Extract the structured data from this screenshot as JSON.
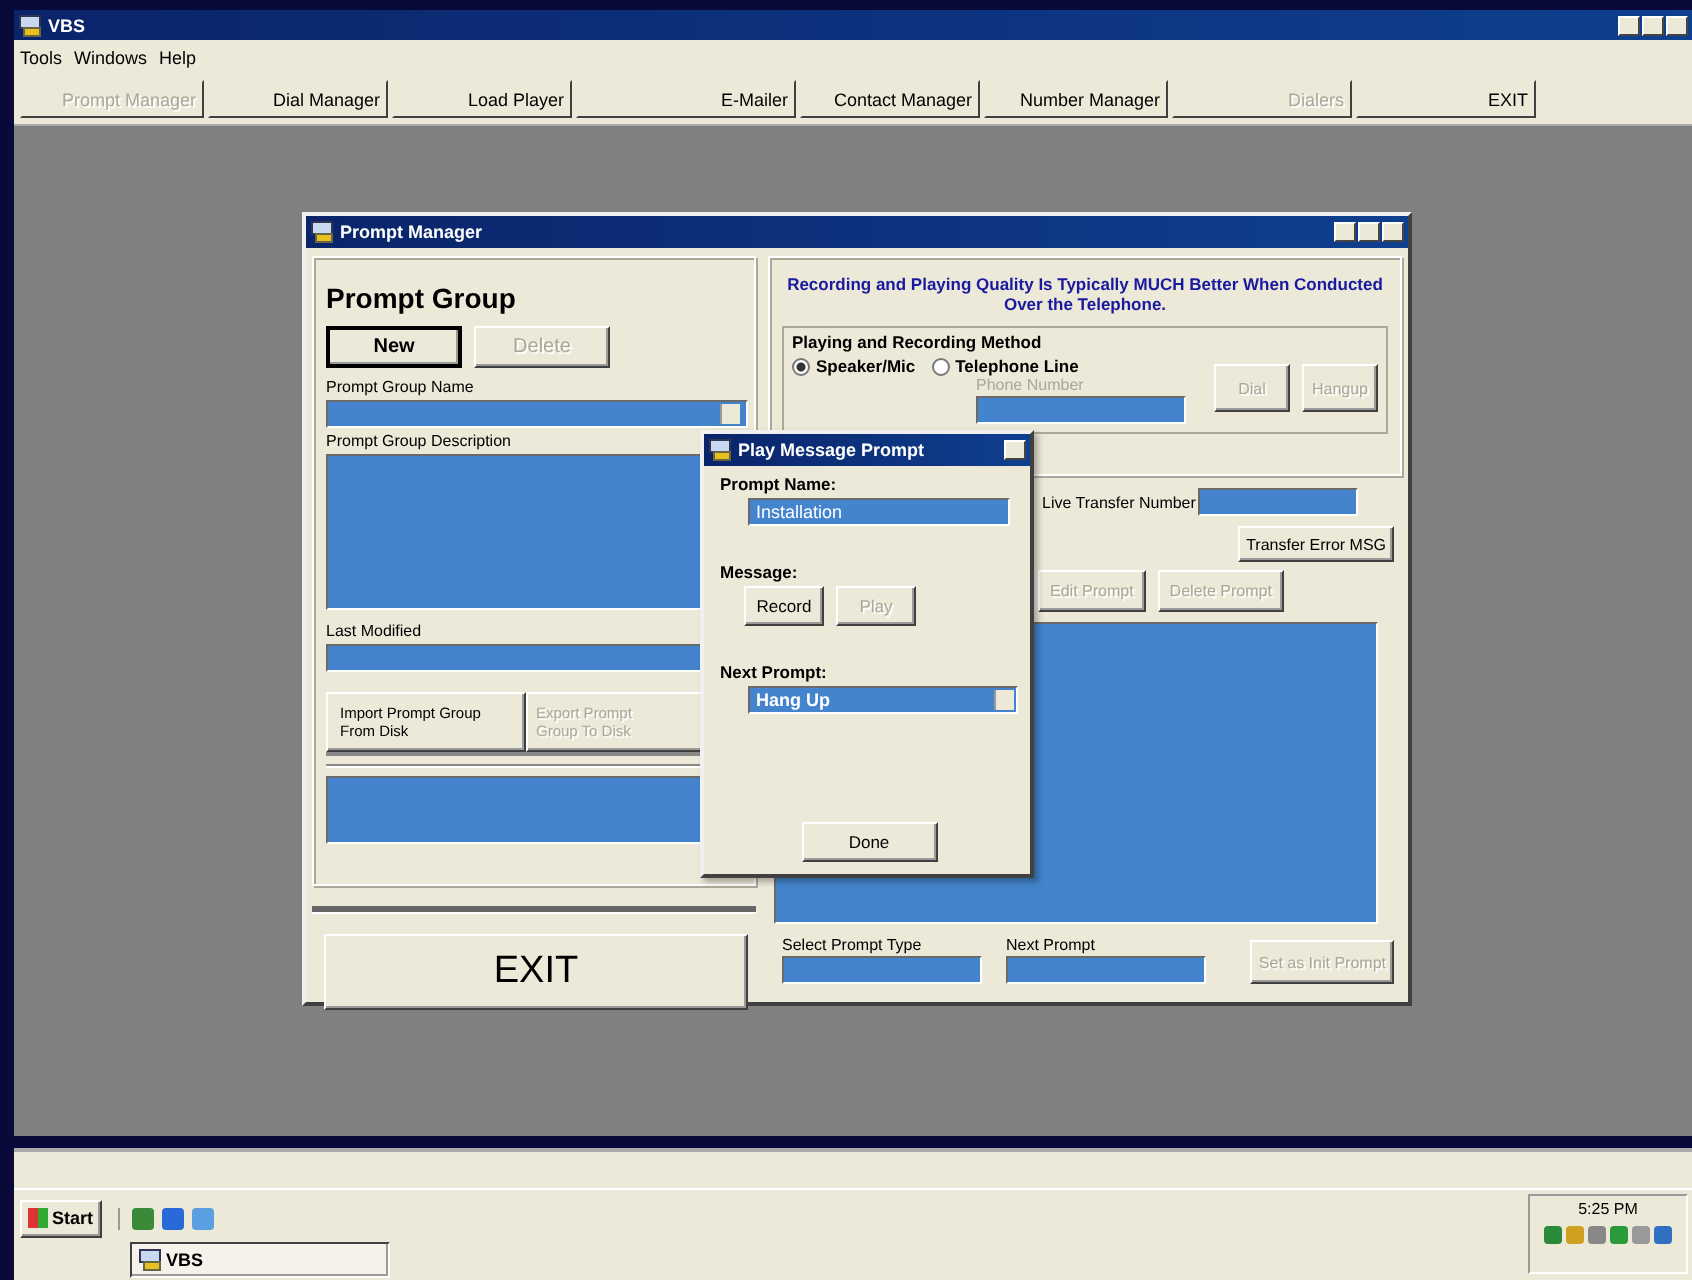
{
  "app": {
    "title": "VBS",
    "menu": [
      "Tools",
      "Windows",
      "Help"
    ],
    "toolbar": [
      {
        "label": "Prompt Manager",
        "disabled": true
      },
      {
        "label": "Dial Manager",
        "disabled": false
      },
      {
        "label": "Load Player",
        "disabled": false
      },
      {
        "label": "E-Mailer",
        "disabled": false
      },
      {
        "label": "Contact Manager",
        "disabled": false
      },
      {
        "label": "Number Manager",
        "disabled": false
      },
      {
        "label": "Dialers",
        "disabled": true
      },
      {
        "label": "EXIT",
        "disabled": false
      }
    ]
  },
  "prompt_manager": {
    "title": "Prompt Manager",
    "heading": "Prompt Group",
    "group_buttons": [
      {
        "label": "New",
        "disabled": false
      },
      {
        "label": "Delete",
        "disabled": true
      }
    ],
    "name_label": "Prompt Group Name",
    "description_label": "Prompt Group Description",
    "last_modified_label": "Last Modified",
    "disk_buttons": [
      {
        "label": "Import Prompt Group From Disk",
        "disabled": false
      },
      {
        "label": "Export Prompt Group To Disk",
        "disabled": true
      }
    ],
    "exit_button": "EXIT",
    "notice": "Recording and Playing Quality Is Typically MUCH Better When Conducted Over the Telephone.",
    "method_group": "Playing and Recording Method",
    "methods": [
      {
        "label": "Speaker/Mic",
        "selected": true
      },
      {
        "label": "Telephone Line",
        "selected": false
      }
    ],
    "phone_number_label": {
      "text": "Phone Number",
      "disabled": true
    },
    "phone_buttons": [
      {
        "label": "Dial",
        "disabled": true
      },
      {
        "label": "Hangup",
        "disabled": true
      }
    ],
    "live_transfer_label": "Live Transfer Number",
    "transfer_error_button": {
      "label": "Transfer Error MSG",
      "disabled": false
    },
    "prompt_buttons": [
      {
        "label": "Edit Prompt",
        "disabled": true
      },
      {
        "label": "Delete Prompt",
        "disabled": true
      }
    ],
    "select_type_label": "Select Prompt Type",
    "next_prompt_label": "Next Prompt",
    "init_button": {
      "label": "Set as Init Prompt",
      "disabled": true
    }
  },
  "dialog": {
    "title": "Play Message Prompt",
    "prompt_name_label": "Prompt Name:",
    "prompt_name": "Installation",
    "message_label": "Message:",
    "message_buttons": [
      {
        "label": "Record",
        "disabled": false
      },
      {
        "label": "Play",
        "disabled": true
      }
    ],
    "next_prompt_label": "Next Prompt:",
    "next_prompt": "Hang Up",
    "done_button": "Done"
  },
  "taskbar": {
    "start": "Start",
    "task": "VBS",
    "clock": "5:25 PM"
  }
}
